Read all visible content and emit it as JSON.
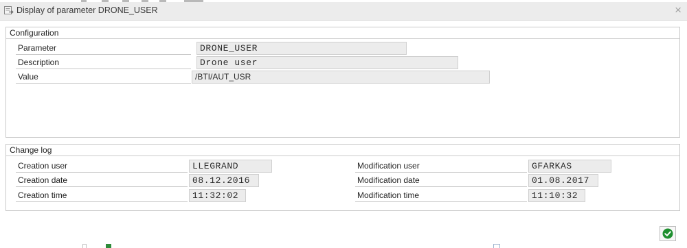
{
  "window": {
    "title": "Display of parameter DRONE_USER",
    "close_glyph": "×",
    "title_icon": "document-arrow-icon",
    "close_icon": "close-icon"
  },
  "configuration": {
    "heading": "Configuration",
    "rows": [
      {
        "label": "Parameter",
        "value": "DRONE_USER"
      },
      {
        "label": "Description",
        "value": "Drone user"
      },
      {
        "label": "Value",
        "value": "/BTI/AUT_USR"
      }
    ]
  },
  "change_log": {
    "heading": "Change log",
    "left": [
      {
        "label": "Creation user",
        "value": "LLEGRAND"
      },
      {
        "label": "Creation date",
        "value": "08.12.2016"
      },
      {
        "label": "Creation time",
        "value": "11:32:02"
      }
    ],
    "right": [
      {
        "label": "Modification user",
        "value": "GFARKAS"
      },
      {
        "label": "Modification date",
        "value": "01.08.2017"
      },
      {
        "label": "Modification time",
        "value": "11:10:32"
      }
    ]
  },
  "actions": {
    "ok_icon": "checkmark-icon",
    "ok_color": "#1e8f2f"
  },
  "colors": {
    "field_background": "#ececec",
    "titlebar_background": "#ececec"
  }
}
